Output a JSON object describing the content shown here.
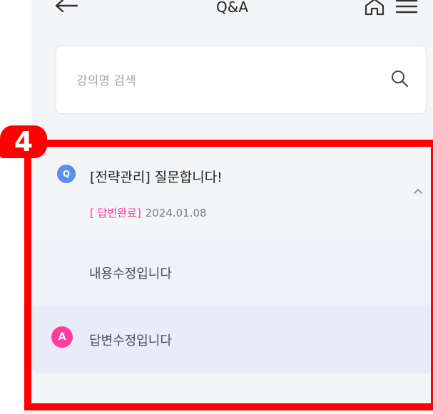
{
  "header": {
    "title": "Q&A",
    "back_icon": "back-arrow-icon",
    "home_icon": "home-icon",
    "menu_icon": "menu-icon"
  },
  "search": {
    "placeholder": "강의명 검색",
    "icon": "search-icon"
  },
  "annotation": {
    "step": "4",
    "color": "#ff0000"
  },
  "qa": {
    "question": {
      "badge": "Q",
      "title": "[전략관리] 질문합니다!",
      "status": "[ 답변완료]",
      "date": "2024.01.08",
      "expanded": true
    },
    "content": "내용수정입니다",
    "answer": {
      "badge": "A",
      "text": "답변수정입니다"
    }
  },
  "colors": {
    "accent_pink": "#ff3d9b",
    "accent_blue": "#5b8def",
    "background": "#f4f5f7"
  }
}
